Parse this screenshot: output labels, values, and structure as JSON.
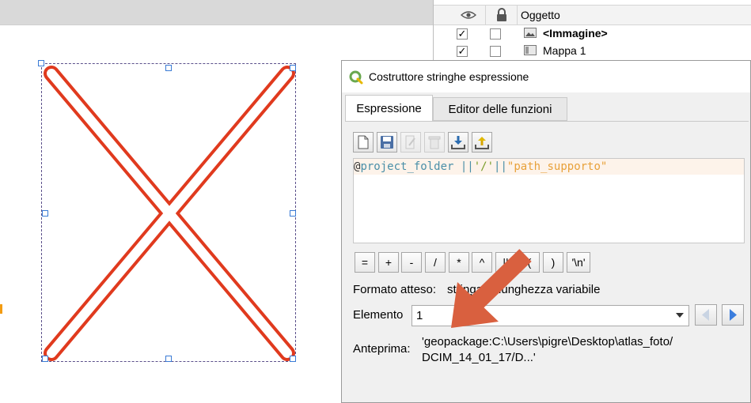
{
  "items_panel": {
    "header_object": "Oggetto",
    "rows": [
      {
        "checked": "✓",
        "label": "<Immagine>",
        "bold": true
      },
      {
        "checked": "✓",
        "label": "Mappa 1",
        "bold": false
      }
    ]
  },
  "dialog": {
    "title": "Costruttore stringhe espressione",
    "tabs": [
      "Espressione",
      "Editor delle funzioni"
    ],
    "expression": {
      "at": "@",
      "var": "project_folder",
      "op1": " ||",
      "str": "'/'",
      "op2": "||",
      "field": "\"path_supporto\""
    },
    "operators": [
      "=",
      "+",
      "-",
      "/",
      "*",
      "^",
      "||",
      "(",
      ")",
      "'\\n'"
    ],
    "formato_label": "Formato atteso:",
    "formato_value": "stringa di lunghezza variabile",
    "elemento_label": "Elemento",
    "elemento_value": "1",
    "anteprima_label": "Anteprima:",
    "anteprima_value": "'geopackage:C:\\Users\\pigre\\Desktop\\atlas_foto/\nDCIM_14_01_17/D...'"
  },
  "colors": {
    "cross_red": "#e03a1e",
    "annotation_arrow": "#d9603f",
    "selection_handle": "#3a7bd5"
  }
}
